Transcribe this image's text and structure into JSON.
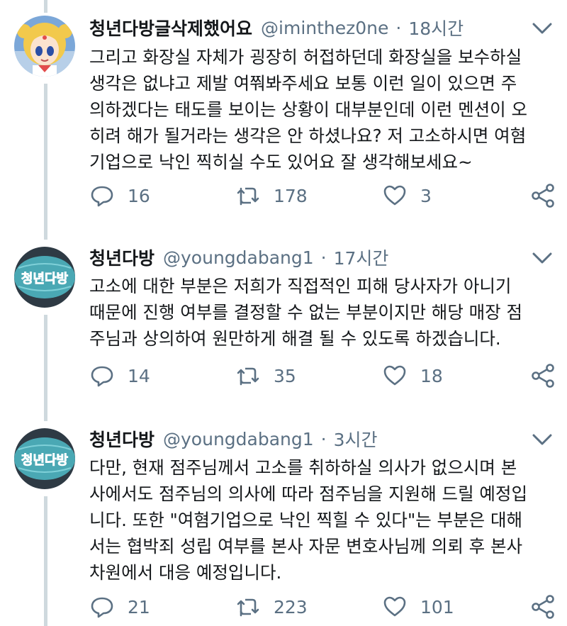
{
  "tweets": [
    {
      "name": "청년다방글삭제했어요",
      "handle": "@iminthez0ne",
      "dot": "·",
      "time": "18시간",
      "lines": [
        "그리고 화장실 자체가 굉장히 허접하던데 화장실을 보수하실",
        "생각은 없냐고 제발 여쭤봐주세요 보통 이런 일이 있으면 주",
        "의하겠다는 태도를 보이는 상황이 대부분인데 이런 멘션이 오",
        "히려 해가 될거라는 생각은 안 하셨나요? 저  고소하시면 여혐",
        "기업으로 낙인 찍히실 수도 있어요 잘 생각해보세요~"
      ],
      "replies": "16",
      "retweets": "178",
      "likes": "3"
    },
    {
      "name": "청년다방",
      "handle": "@youngdabang1",
      "dot": "·",
      "time": "17시간",
      "avatar_text": "청년다방",
      "lines": [
        "고소에 대한 부분은 저희가 직접적인 피해 당사자가 아니기",
        "때문에 진행 여부를 결정할 수 없는 부분이지만 해당 매장 점",
        "주님과 상의하여 원만하게 해결 될 수 있도록 하겠습니다."
      ],
      "replies": "14",
      "retweets": "35",
      "likes": "18"
    },
    {
      "name": "청년다방",
      "handle": "@youngdabang1",
      "dot": "·",
      "time": "3시간",
      "avatar_text": "청년다방",
      "lines": [
        "다만, 현재 점주님께서 고소를 취하하실 의사가 없으시며 본",
        "사에서도 점주님의 의사에 따라 점주님을 지원해 드릴 예정입",
        "니다. 또한 \"여혐기업으로 낙인 찍힐 수 있다\"는 부분은 대해",
        "서는 협박죄 성립 여부를 본사 자문 변호사님께 의뢰 후 본사",
        "차원에서 대응 예정입니다."
      ],
      "replies": "21",
      "retweets": "223",
      "likes": "101"
    }
  ],
  "icons": {
    "reply": "reply-icon",
    "retweet": "retweet-icon",
    "like": "heart-icon",
    "share": "share-icon",
    "menu": "chevron-down-icon"
  },
  "colors": {
    "muted": "#5b7083",
    "text": "#14171a",
    "thread_line": "#cfd9de",
    "brand_avatar_bg": "#4aa8b4",
    "brand_avatar_text": "#1e6fb8"
  }
}
